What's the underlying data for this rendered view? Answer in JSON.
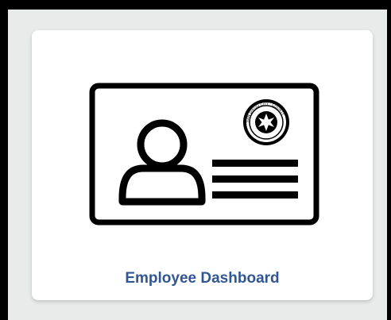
{
  "tile": {
    "label": "Employee Dashboard",
    "icon": "id-badge-icon",
    "seal_icon": "seal-icon",
    "seal_text": "SAN DIEGO CITY · COUNTY"
  },
  "colors": {
    "label": "#315694",
    "tile_bg": "#ffffff",
    "page_bg": "#e9ebea",
    "frame": "#000000"
  }
}
